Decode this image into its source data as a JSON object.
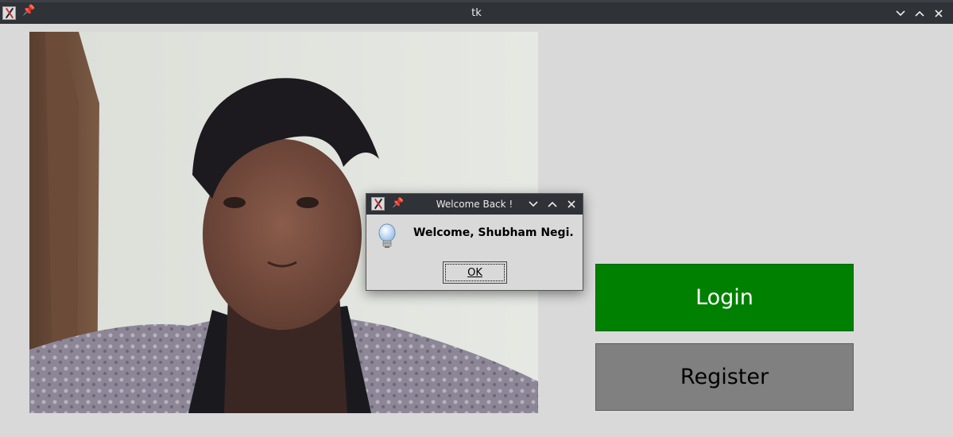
{
  "main_window": {
    "title": "tk",
    "pin_glyph": "📌",
    "controls": {
      "minimize": "chevron-down-icon",
      "maximize": "chevron-up-icon",
      "close": "close-icon"
    }
  },
  "buttons": {
    "login_label": "Login",
    "register_label": "Register",
    "login_color": "#008000",
    "register_color": "#808080"
  },
  "dialog": {
    "title": "Welcome Back !",
    "message": "Welcome, Shubham Negi.",
    "ok_label": "OK",
    "icon": "info-bulb-icon"
  }
}
